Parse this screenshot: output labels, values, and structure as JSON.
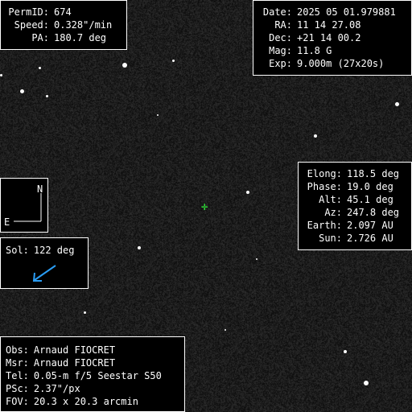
{
  "top_left": {
    "rows": [
      {
        "label": "PermID:",
        "value": "674"
      },
      {
        "label": "Speed:",
        "value": "0.328\"/min"
      },
      {
        "label": "PA:",
        "value": "180.7 deg"
      }
    ]
  },
  "top_right": {
    "rows": [
      {
        "label": "Date:",
        "value": "2025 05 01.979881"
      },
      {
        "label": "RA:",
        "value": "11 14 27.08"
      },
      {
        "label": "Dec:",
        "value": "+21 14 00.2"
      },
      {
        "label": "Mag:",
        "value": "11.8 G"
      },
      {
        "label": "Exp:",
        "value": "9.000m (27x20s)"
      }
    ]
  },
  "mid_right": {
    "rows": [
      {
        "label": "Elong:",
        "value": "118.5 deg"
      },
      {
        "label": "Phase:",
        "value": "19.0 deg"
      },
      {
        "label": "Alt:",
        "value": "45.1 deg"
      },
      {
        "label": "Az:",
        "value": "247.8 deg"
      },
      {
        "label": "Earth:",
        "value": "2.097 AU"
      },
      {
        "label": "Sun:",
        "value": "2.726 AU"
      }
    ]
  },
  "compass": {
    "north": "N",
    "east": "E"
  },
  "sol": {
    "label": "Sol:",
    "value": "122 deg",
    "arrow_color": "#2a9df4"
  },
  "bottom_left": {
    "rows": [
      {
        "label": "Obs:",
        "value": "Arnaud FIOCRET"
      },
      {
        "label": "Msr:",
        "value": "Arnaud FIOCRET"
      },
      {
        "label": "Tel:",
        "value": "0.05-m f/5 Seestar S50"
      },
      {
        "label": "PSc:",
        "value": "2.37\"/px"
      },
      {
        "label": "FOV:",
        "value": "20.3 x 20.3 arcmin"
      }
    ]
  },
  "target_color": "#30ff3a",
  "colors": {
    "background": "#0b0b0b",
    "panel_border": "#ffffff",
    "text": "#ffffff"
  }
}
